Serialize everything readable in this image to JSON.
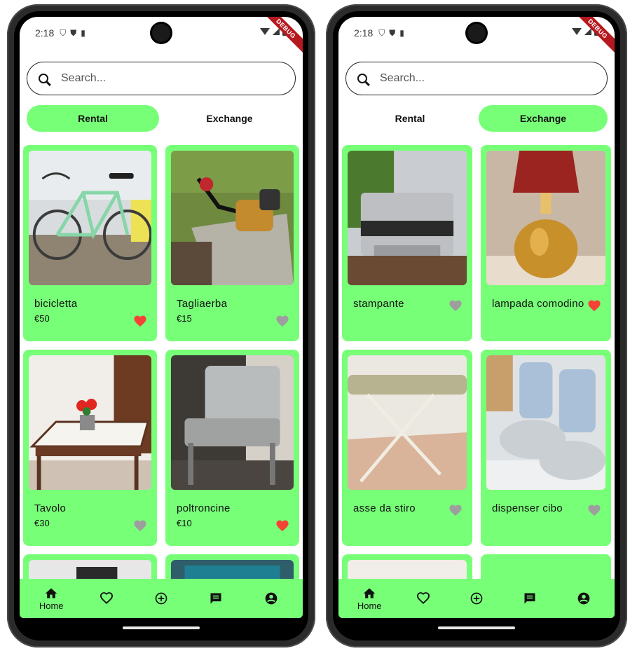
{
  "status_bar": {
    "time": "2:18",
    "debug_banner": "DEBUG"
  },
  "search": {
    "placeholder": "Search..."
  },
  "tabs": [
    "Rental",
    "Exchange"
  ],
  "colors": {
    "accent_green": "#77ff77",
    "heart_liked": "#f44336",
    "heart_unliked": "#9e9e9e"
  },
  "left_screen": {
    "active_tab": "Rental",
    "items": [
      {
        "name": "bicicletta",
        "price": "€50",
        "liked": true
      },
      {
        "name": "Tagliaerba",
        "price": "€15",
        "liked": false
      },
      {
        "name": "Tavolo",
        "price": "€30",
        "liked": false
      },
      {
        "name": "poltroncine",
        "price": "€10",
        "liked": true
      }
    ]
  },
  "right_screen": {
    "active_tab": "Exchange",
    "items": [
      {
        "name": "stampante",
        "liked": false
      },
      {
        "name": "lampada comodino",
        "liked": true
      },
      {
        "name": "asse da stiro",
        "liked": false
      },
      {
        "name": "dispenser cibo",
        "liked": false
      }
    ]
  },
  "bottom_nav": [
    {
      "icon": "home-icon",
      "label": "Home"
    },
    {
      "icon": "heart-outline-icon",
      "label": ""
    },
    {
      "icon": "add-circle-icon",
      "label": ""
    },
    {
      "icon": "chat-icon",
      "label": ""
    },
    {
      "icon": "account-icon",
      "label": ""
    }
  ]
}
